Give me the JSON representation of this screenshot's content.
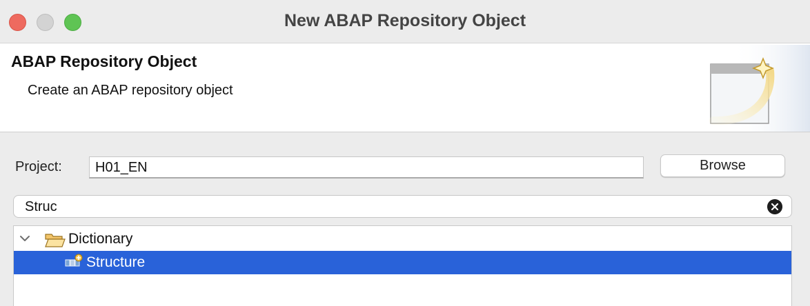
{
  "window": {
    "title": "New ABAP Repository Object"
  },
  "banner": {
    "title": "ABAP Repository Object",
    "description": "Create an ABAP repository object",
    "icon": "new-object-wizard-icon"
  },
  "project": {
    "label": "Project:",
    "value": "H01_EN",
    "browse_label": "Browse"
  },
  "filter": {
    "value": "Struc",
    "clear_icon": "clear-icon"
  },
  "tree": {
    "items": [
      {
        "label": "Dictionary",
        "icon": "open-folder-icon",
        "expanded": true,
        "selected": false
      },
      {
        "label": "Structure",
        "icon": "structure-icon",
        "selected": true
      }
    ]
  },
  "colors": {
    "selection": "#2962d9",
    "close": "#ee6a5f",
    "minimize": "#d3d3d3",
    "maximize": "#5fc454"
  }
}
